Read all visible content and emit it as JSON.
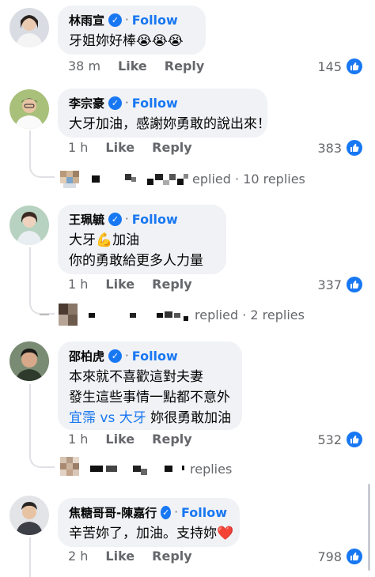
{
  "comments": [
    {
      "name": "林雨宣",
      "follow": "Follow",
      "lines": [
        "牙姐妳好棒😭😭😭"
      ],
      "time": "38 m",
      "like_label": "Like",
      "reply_label": "Reply",
      "likes": "145"
    },
    {
      "name": "李宗豪",
      "follow": "Follow",
      "lines": [
        "大牙加油，感謝妳勇敢的說出來！"
      ],
      "time": "1 h",
      "like_label": "Like",
      "reply_label": "Reply",
      "likes": "383",
      "replies_text": "eplied · 10 replies"
    },
    {
      "name": "王珮毓",
      "follow": "Follow",
      "lines": [
        "大牙💪加油",
        "你的勇敢給更多人力量"
      ],
      "time": "1 h",
      "like_label": "Like",
      "reply_label": "Reply",
      "likes": "337",
      "replies_text": "replied · 2 replies"
    },
    {
      "name": "邵柏虎",
      "follow": "Follow",
      "lines": [
        "本來就不喜歡這對夫妻",
        "發生這些事情一點都不意外"
      ],
      "link_text": "宜霈 vs 大牙",
      "line3_rest": " 妳很勇敢加油",
      "time": "1 h",
      "like_label": "Like",
      "reply_label": "Reply",
      "likes": "532",
      "replies_text": "replies"
    },
    {
      "name": "焦糖哥哥-陳嘉行",
      "follow": "Follow",
      "lines": [
        "辛苦妳了，加油。支持妳❤️"
      ],
      "time": "2 h",
      "like_label": "Like",
      "reply_label": "Reply",
      "likes": "798"
    }
  ],
  "verified_mark": "✓",
  "separator": "·",
  "icons": [
    "verified-badge-icon",
    "like-thumb-icon"
  ],
  "colors": {
    "accent": "#1877f2",
    "bubble": "#f0f2f5",
    "muted": "#65676b"
  }
}
